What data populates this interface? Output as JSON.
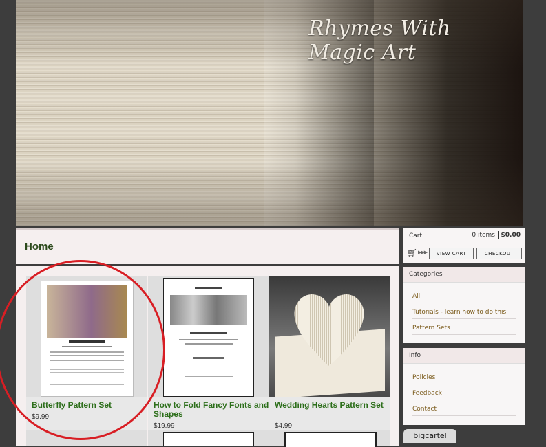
{
  "banner": {
    "title": "Rhymes With Magic Art"
  },
  "page": {
    "heading": "Home"
  },
  "products": [
    {
      "name": "Butterfly Pattern Set",
      "price": "$9.99"
    },
    {
      "name": "How to Fold Fancy Fonts and Shapes",
      "price": "$19.99"
    },
    {
      "name": "Wedding Hearts Pattern Set",
      "price": "$4.99"
    }
  ],
  "cart": {
    "label": "Cart",
    "items": "0 items",
    "total": "$0.00",
    "view_cart": "VIEW CART",
    "checkout": "CHECKOUT"
  },
  "categories": {
    "title": "Categories",
    "items": [
      "All",
      "Tutorials - learn how to do this",
      "Pattern Sets"
    ]
  },
  "info": {
    "title": "Info",
    "items": [
      "Policies",
      "Feedback",
      "Contact"
    ]
  },
  "footer": {
    "badge": "bigcartel"
  },
  "colors": {
    "accent_green": "#2c6e1a",
    "annotation_red": "#d81e24"
  }
}
